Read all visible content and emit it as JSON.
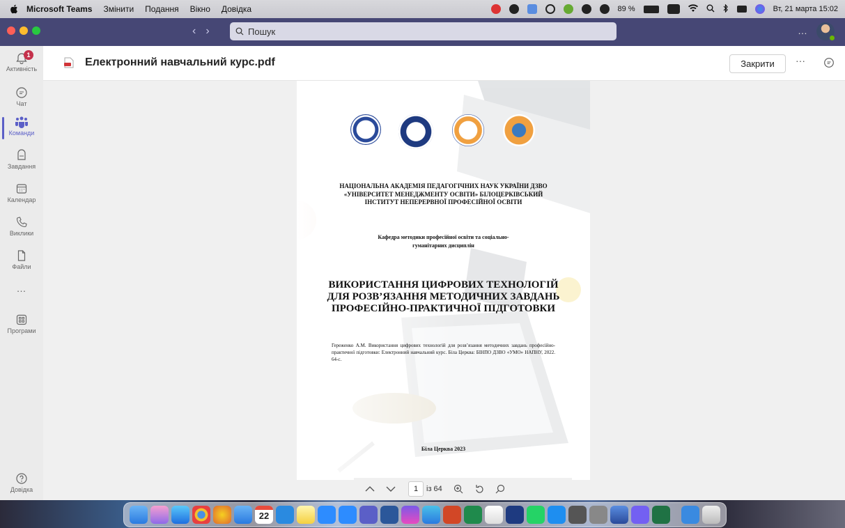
{
  "menubar": {
    "app_name": "Microsoft Teams",
    "items": [
      "Змінити",
      "Подання",
      "Вікно",
      "Довідка"
    ],
    "battery": "89 %",
    "datetime": "Вт, 21 марта  15:02"
  },
  "titlebar": {
    "search_placeholder": "Пошук",
    "more": "…"
  },
  "rail": {
    "activity_badge": "1",
    "items": [
      {
        "label": "Активність",
        "icon": "bell-icon"
      },
      {
        "label": "Чат",
        "icon": "chat-icon"
      },
      {
        "label": "Команди",
        "icon": "teams-icon",
        "active": true
      },
      {
        "label": "Завдання",
        "icon": "assignments-icon"
      },
      {
        "label": "Календар",
        "icon": "calendar-icon"
      },
      {
        "label": "Виклики",
        "icon": "phone-icon"
      },
      {
        "label": "Файли",
        "icon": "file-icon"
      }
    ],
    "more": "…",
    "apps_label": "Програми",
    "help_label": "Довідка"
  },
  "viewer": {
    "file_name": "Електронний навчальний курс.pdf",
    "close_label": "Закрити",
    "more": "···"
  },
  "document": {
    "institution": "НАЦІОНАЛЬНА АКАДЕМІЯ ПЕДАГОГІЧНИХ НАУК УКРАЇНИ ДЗВО «УНІВЕРСИТЕТ МЕНЕДЖМЕНТУ ОСВІТИ» БІЛОЦЕРКІВСЬКИЙ ІНСТИТУТ НЕПЕРЕРВНОЇ ПРОФЕСІЙНОЇ ОСВІТИ",
    "department": "Кафедра методики професійної освіти та соціально-гуманітарних дисциплін",
    "title": "ВИКОРИСТАННЯ ЦИФРОВИХ ТЕХНОЛОГІЙ ДЛЯ РОЗВ’ЯЗАННЯ МЕТОДИЧНИХ ЗАВДАНЬ ПРОФЕСІЙНО-ПРАКТИЧНОЇ ПІДГОТОВКИ",
    "citation": "Гереженко А.М. Використання цифрових технологій для розв’язання методичних завдань професійно-практичної підготовки: Електронний навчальний курс. Біла Церква: БІНПО ДЗВО «УМО» НАПНУ, 2022. 64-с.",
    "city_year": "Біла Церква 2023"
  },
  "pdf_toolbar": {
    "current_page": "1",
    "total_pages": "із 64"
  },
  "dock": {
    "calendar_day": "22"
  },
  "colors": {
    "teams_purple": "#464775",
    "accent": "#5b5fc7",
    "badge_red": "#c4314b"
  }
}
